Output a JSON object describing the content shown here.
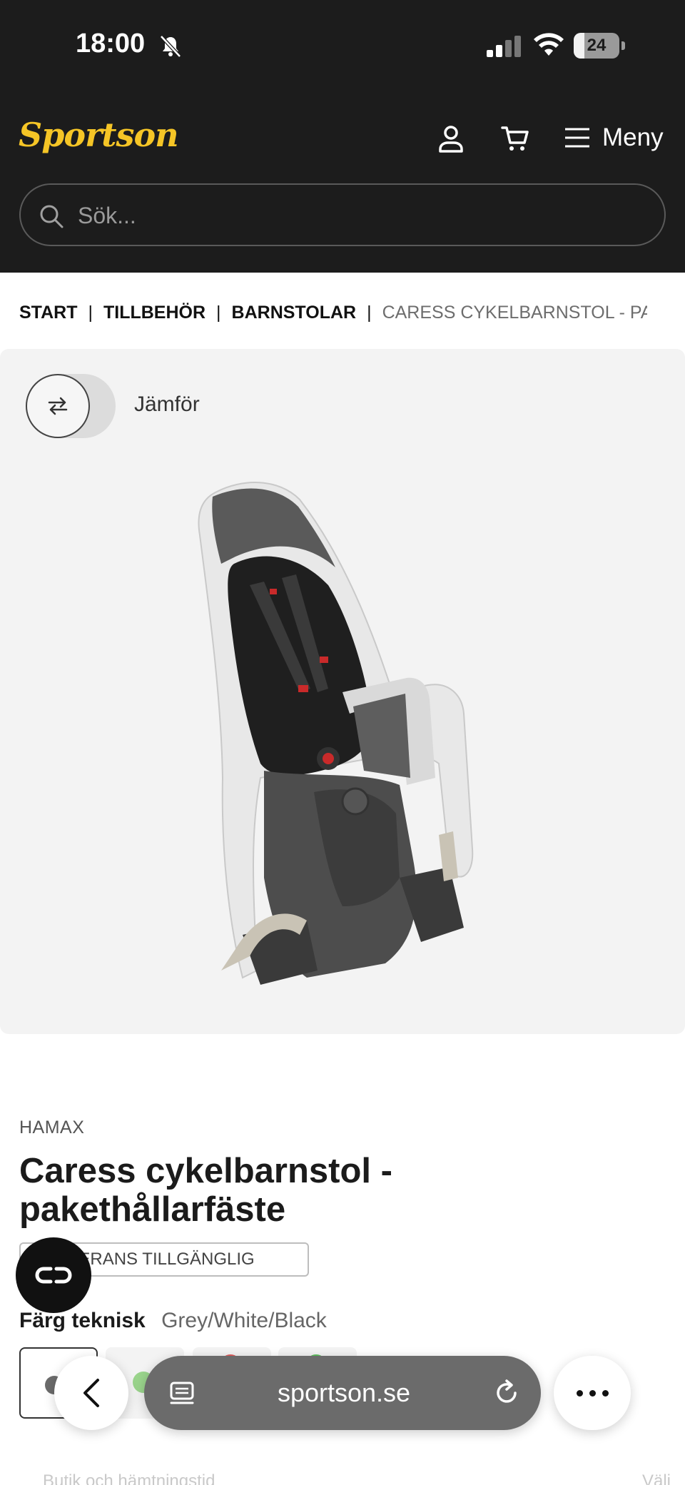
{
  "status_bar": {
    "time": "18:00",
    "battery_level": "24",
    "battery_fraction": 0.24
  },
  "header": {
    "logo_text": "Sportson",
    "menu_label": "Meny",
    "search_placeholder": "Sök...",
    "icons": [
      "user-icon",
      "cart-icon",
      "hamburger-icon",
      "search-icon"
    ],
    "logo_color": "#f5c526",
    "background_color": "#1c1c1c"
  },
  "breadcrumb": {
    "items": [
      "START",
      "TILLBEHÖR",
      "BARNSTOLAR"
    ],
    "current": "CARESS CYKELBARNSTOL - PAKETHÅLLARFÄSTE"
  },
  "gallery": {
    "compare_label": "Jämför"
  },
  "product": {
    "brand": "HAMAX",
    "title": "Caress cykelbarnstol - pakethållarfäste",
    "badge": "LEVERANS TILLGÄNGLIG",
    "color_label": "Färg teknisk",
    "color_value": "Grey/White/Black"
  },
  "store_row": {
    "left": "Butik och hämtningstid",
    "right": "Välj"
  },
  "browser": {
    "url": "sportson.se"
  }
}
